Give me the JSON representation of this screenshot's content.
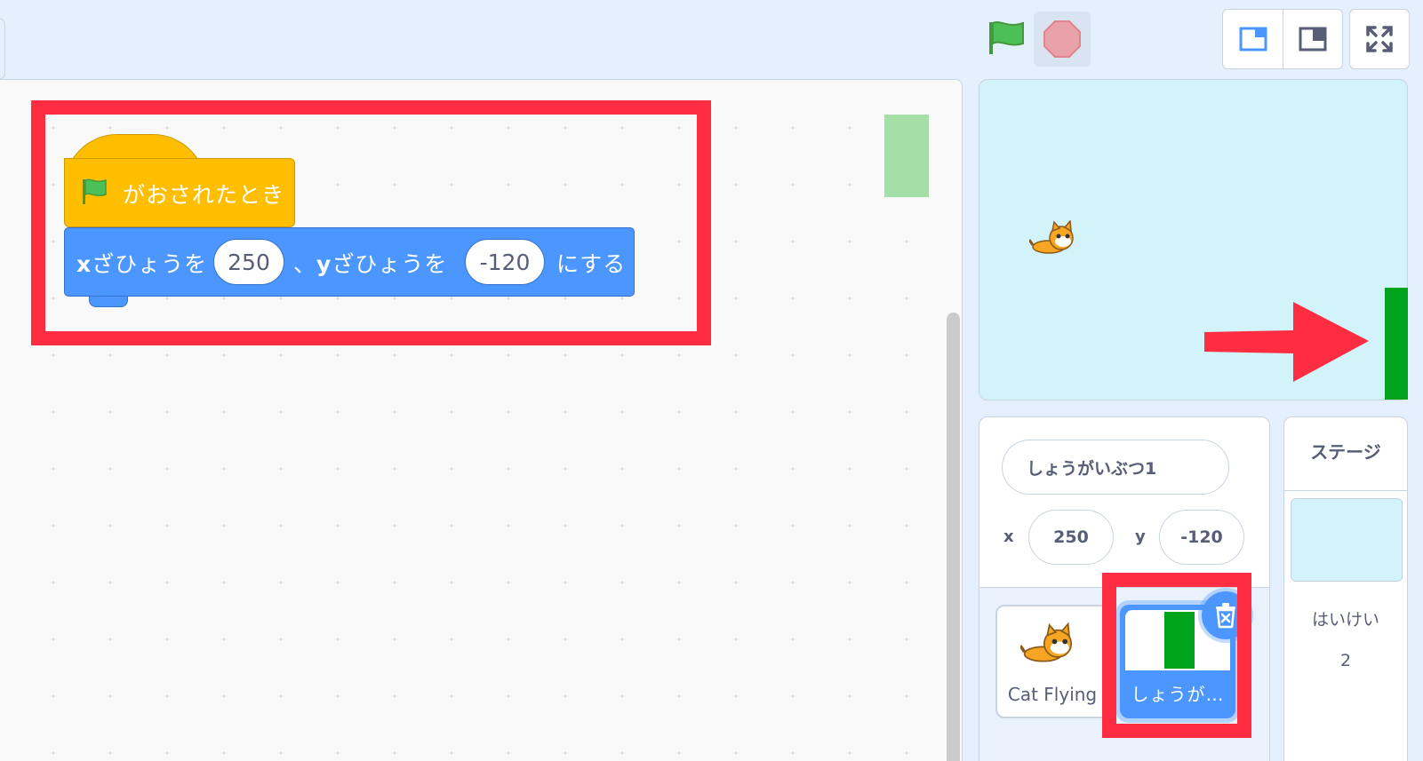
{
  "colors": {
    "event_block": "#ffbf00",
    "motion_block": "#4c97ff",
    "highlight": "#ff2d42",
    "obstacle_green": "#00a31c",
    "stage_bg": "#d3f3fa"
  },
  "toolbar": {
    "green_flag_icon": "green-flag-icon",
    "stop_icon": "stop-sign-icon",
    "layout_small_icon": "small-stage-layout-icon",
    "layout_normal_icon": "normal-stage-layout-icon",
    "fullscreen_icon": "fullscreen-icon"
  },
  "script": {
    "hat_label": "がおされたとき",
    "motion_x_prefix": "x",
    "motion_x_label": "ざひょうを",
    "x_value": "250",
    "separator": "、",
    "motion_y_prefix": "y",
    "motion_y_label": "ざひょうを",
    "y_value": "-120",
    "motion_suffix": "にする"
  },
  "sprite_info": {
    "name": "しょうがいぶつ1",
    "x_label": "x",
    "x_value": "250",
    "y_label": "y",
    "y_value": "-120"
  },
  "sprites": [
    {
      "name": "Cat Flying",
      "selected": false
    },
    {
      "name": "しょうが…",
      "selected": true
    }
  ],
  "stage_pane": {
    "title": "ステージ",
    "backdrops_label": "はいけい",
    "backdrops_count": "2"
  }
}
